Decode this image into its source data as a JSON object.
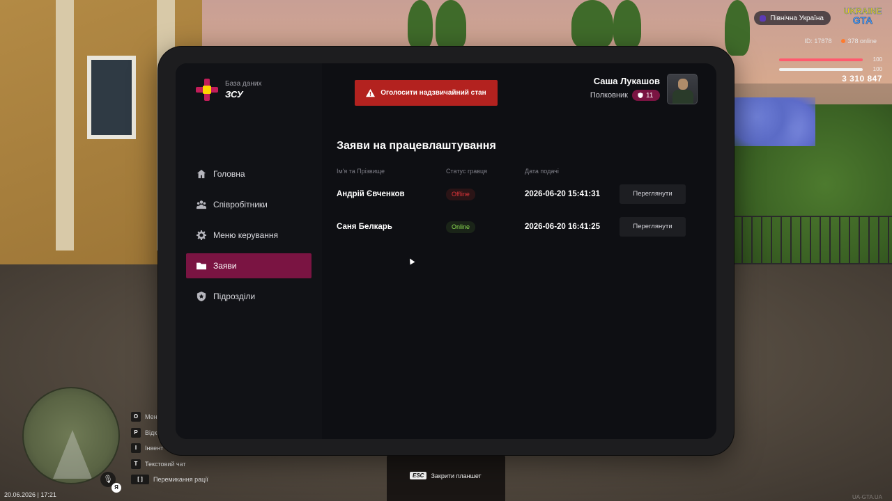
{
  "hud": {
    "region": "Північна Україна",
    "logo_line1": "UKRAINE",
    "logo_line2": "GTA",
    "player_id": "ID: 17878",
    "online": "378 online",
    "health": "100",
    "armor": "100",
    "money": "3 310 847"
  },
  "tablet": {
    "brand_small": "База даних",
    "brand_name": "ЗСУ",
    "emergency_label": "Оголосити надзвичайний стан",
    "user": {
      "name": "Саша Лукашов",
      "rank": "Полковник",
      "rank_level": "11"
    },
    "nav": [
      {
        "label": "Головна",
        "icon": "home-icon"
      },
      {
        "label": "Співробітники",
        "icon": "users-icon"
      },
      {
        "label": "Меню керування",
        "icon": "gear-icon"
      },
      {
        "label": "Заяви",
        "icon": "folder-icon",
        "active": true
      },
      {
        "label": "Підрозділи",
        "icon": "shield-icon"
      }
    ],
    "page_title": "Заяви на працевлаштування",
    "columns": [
      "Ім'я та Прізвище",
      "Статус гравця",
      "Дата подачі"
    ],
    "rows": [
      {
        "name": "Андрій Євченков",
        "status": "Offline",
        "date": "2026-06-20 15:41:31",
        "action": "Переглянути"
      },
      {
        "name": "Саня Белкарь",
        "status": "Online",
        "date": "2026-06-20 16:41:25",
        "action": "Переглянути"
      }
    ]
  },
  "controls": {
    "keys": [
      {
        "key": "O",
        "label": "Мені"
      },
      {
        "key": "P",
        "label": "Відк"
      },
      {
        "key": "I",
        "label": "Інвент"
      },
      {
        "key": "T",
        "label": "Текстовий чат"
      },
      {
        "key": "[ ]",
        "label": "Перемикання рації"
      }
    ],
    "esc_key": "ESC",
    "esc_label": "Закрити планшет",
    "mic_badge": "Я",
    "datetime": "20.06.2026 | 17:21",
    "watermark": "UA-GTA.UA"
  },
  "colors": {
    "accent": "#7a1442",
    "emergency": "#b3221f",
    "offline": "#e0353a",
    "online": "#8bdc50"
  }
}
